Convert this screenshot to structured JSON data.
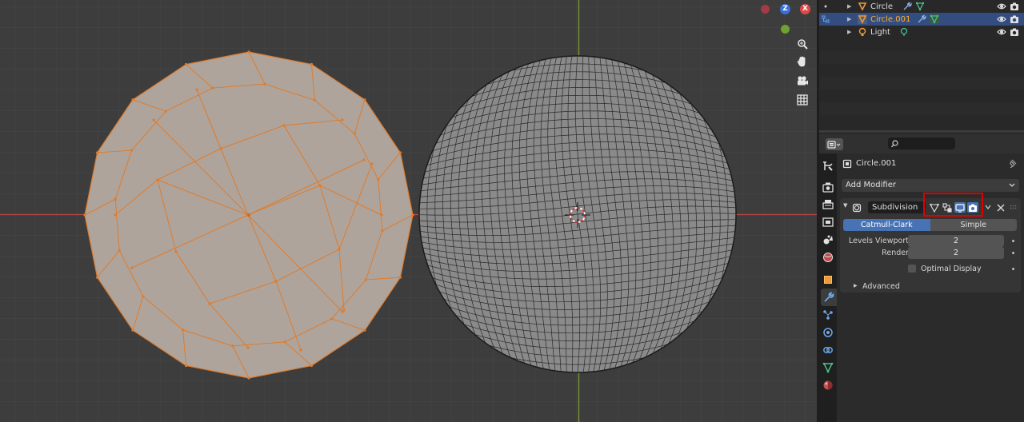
{
  "viewport": {
    "gizmo": {
      "z_label": "Z",
      "x_label": "X"
    },
    "nav_icons": [
      "zoom-icon",
      "hand-pan-icon",
      "camera-icon",
      "grid-icon"
    ],
    "colors": {
      "grid_bg": "#3d3d3d",
      "x_axis": "#b84545",
      "y_axis": "#7a9a35",
      "edge_selected": "#e07b2a",
      "face_selected": "#aea49c",
      "mesh_fill": "#888888"
    }
  },
  "outliner": {
    "rows": [
      {
        "label": "Circle",
        "selected": false,
        "icon": "mesh-object-icon"
      },
      {
        "label": "Circle.001",
        "selected": true,
        "icon": "mesh-object-icon"
      },
      {
        "label": "Light",
        "selected": false,
        "icon": "light-object-icon"
      }
    ]
  },
  "properties": {
    "object_name": "Circle.001",
    "add_modifier_label": "Add Modifier",
    "modifier": {
      "name": "Subdivision",
      "mode_options": [
        "Catmull-Clark",
        "Simple"
      ],
      "selected_mode": "Catmull-Clark",
      "levels_viewport_label": "Levels Viewport",
      "levels_viewport_value": "2",
      "render_label": "Render",
      "render_value": "2",
      "optimal_display_label": "Optimal Display",
      "advanced_label": "Advanced"
    },
    "tabs": [
      "tool-icon",
      "render-icon",
      "output-icon",
      "view-layer-icon",
      "scene-icon",
      "world-icon",
      "object-icon",
      "modifier-icon",
      "particles-icon",
      "physics-icon",
      "constraints-icon",
      "data-icon",
      "material-icon"
    ],
    "active_tab": "modifier-icon"
  }
}
